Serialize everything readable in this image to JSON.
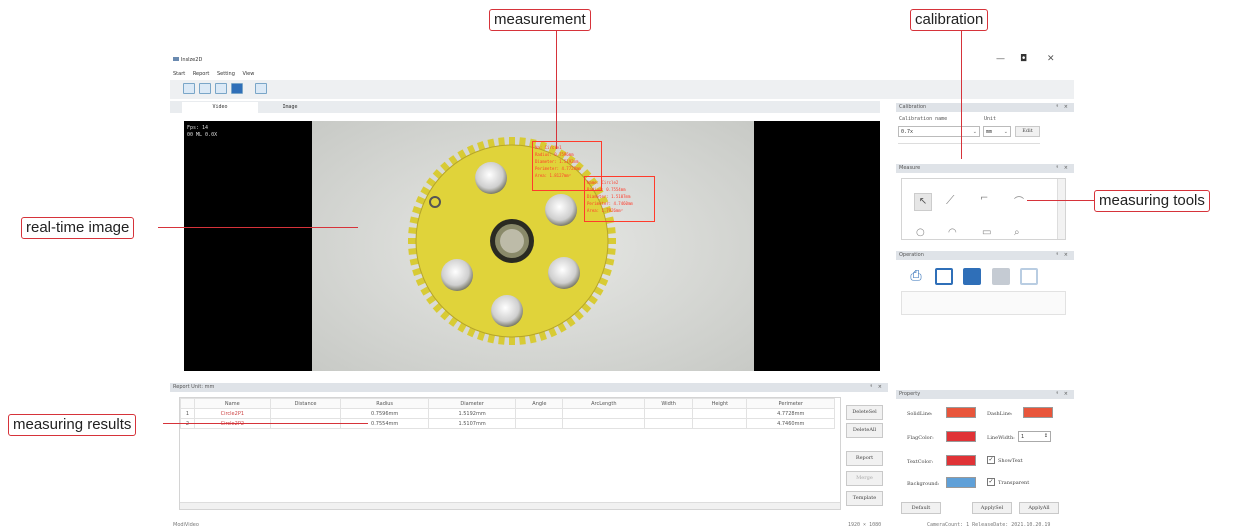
{
  "window": {
    "title": "Inslze2D",
    "menu": [
      "Start",
      "Report",
      "Setting",
      "View"
    ],
    "controls": {
      "minimize": "—",
      "restore": "◘",
      "close": "✕"
    }
  },
  "tabs": [
    "Video",
    "Image"
  ],
  "video": {
    "overlay_line1": "Fps: 14",
    "overlay_line2": "00 ML  0.0X",
    "measure_box1": [
      "Na: Circle1",
      "Radius: 0.7596mm",
      "Diameter: 1.5192mm",
      "Perimeter: 4.7728mm",
      "Area: 1.8127mm²"
    ],
    "measure_box2": [
      "Name: Circle2",
      "Radius: 0.7554mm",
      "Diameter: 1.5107mm",
      "Perimeter: 4.7460mm",
      "Area: 1.7926mm²"
    ]
  },
  "calibration": {
    "panel_title": "Calibration",
    "name_label": "Calibration name",
    "unit_label": "Unit",
    "name_value": "0.7x",
    "unit_value": "mm",
    "edit_label": "Edit"
  },
  "measure_panel": {
    "title": "Measure"
  },
  "operation_panel": {
    "title": "Operation"
  },
  "report": {
    "title": "Report   Unit: mm",
    "columns": [
      "Name",
      "Distance",
      "Radius",
      "Diameter",
      "Angle",
      "ArcLength",
      "Width",
      "Height",
      "Perimeter"
    ],
    "rows": [
      {
        "num": "1",
        "name": "Circle2P1",
        "distance": "",
        "radius": "0.7596mm",
        "diameter": "1.5192mm",
        "angle": "",
        "arclength": "",
        "width": "",
        "height": "",
        "perimeter": "4.7728mm"
      },
      {
        "num": "2",
        "name": "Circle2P2",
        "distance": "",
        "radius": "0.7554mm",
        "diameter": "1.5107mm",
        "angle": "",
        "arclength": "",
        "width": "",
        "height": "",
        "perimeter": "4.7460mm"
      }
    ],
    "buttons": [
      "DeleteSel",
      "DeleteAll",
      "Report",
      "Merge",
      "Template"
    ]
  },
  "property": {
    "title": "Property",
    "solid_line": "SolidLine:",
    "dash_line": "DashLine:",
    "flag_color": "FlagColor:",
    "line_width": "LineWidth:",
    "line_width_value": "1",
    "text_color": "TextColor:",
    "show_text": "ShowText",
    "background": "Background:",
    "transparent": "Transparent",
    "default_btn": "Default",
    "apply_sel_btn": "ApplySel",
    "apply_all_btn": "ApplyAll",
    "colors": {
      "solid": "#e8553b",
      "dash": "#e8553b",
      "flag": "#e03236",
      "text": "#e03236",
      "background": "#5fa0d8"
    }
  },
  "status": {
    "left": "ModiVideo",
    "resolution": "1920 × 1080",
    "camera": "CameraCount: 1   ReleaseDate: 2021.10.20.19"
  },
  "callouts": {
    "measurement": "measurement",
    "calibration": "calibration",
    "realtime": "real-time image",
    "tools": "measuring tools",
    "results": "measuring results"
  }
}
